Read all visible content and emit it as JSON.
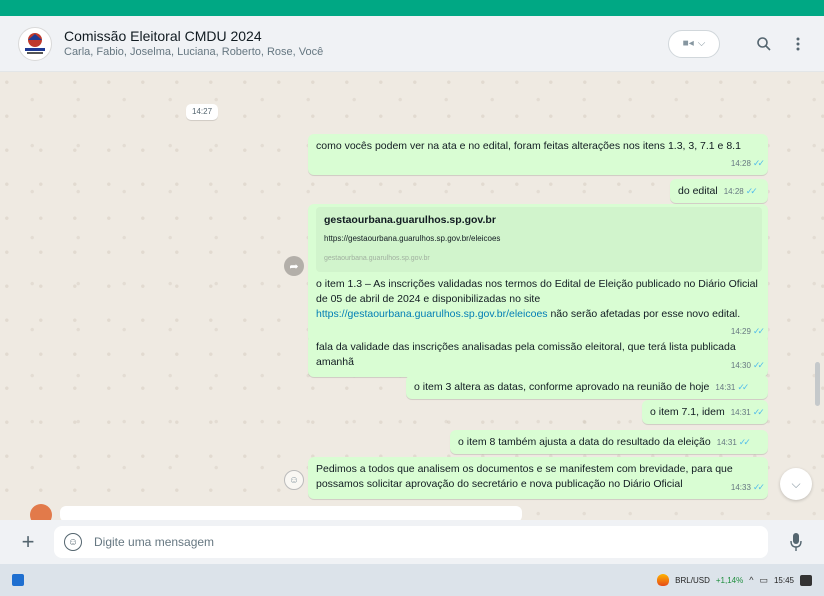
{
  "header": {
    "title": "Comissão Eleitoral CMDU 2024",
    "participants": "Carla, Fabio, Joselma, Luciana, Roberto, Rose, Você"
  },
  "date_chip": "14:27",
  "messages": [
    {
      "text": "como vocês podem ver na ata e no edital, foram feitas alterações nos itens 1.3, 3, 7.1 e 8.1",
      "time": "14:28"
    },
    {
      "text": "do edital",
      "time": "14:28"
    },
    {
      "link_preview": {
        "domain": "gestaourbana.guarulhos.sp.gov.br",
        "url": "https://gestaourbana.guarulhos.sp.gov.br/eleicoes",
        "small": "gestaourbana.guarulhos.sp.gov.br"
      },
      "text_before": "o item 1.3 – As inscrições validadas nos termos do Edital de Eleição publicado no Diário Oficial de 05 de abril de 2024 e disponibilizadas  no site ",
      "link": "https://gestaourbana.guarulhos.sp.gov.br/eleicoes",
      "text_after": " não serão afetadas por esse novo edital.",
      "time": "14:29"
    },
    {
      "text": "fala da validade das inscrições analisadas pela comissão eleitoral, que terá lista publicada amanhã",
      "time": "14:30"
    },
    {
      "text": "o item 3 altera as datas, conforme aprovado na reunião de hoje",
      "time": "14:31"
    },
    {
      "text": "o item 7.1, idem",
      "time": "14:31"
    },
    {
      "text": "o item 8 também ajusta a data do resultado da eleição",
      "time": "14:31"
    },
    {
      "text": "Pedimos a todos que analisem os documentos e se manifestem com brevidade, para que possamos solicitar aprovação do secretário e nova publicação no Diário Oficial",
      "time": "14:33"
    }
  ],
  "composer": {
    "placeholder": "Digite uma mensagem"
  },
  "taskbar": {
    "ticker": "BRL/USD",
    "change": "+1,14%",
    "clock": "15:45"
  },
  "colors": {
    "accent": "#00a884",
    "outgoing_bubble": "#d9fdd3",
    "read_ticks": "#53bdeb",
    "link": "#027eb5"
  },
  "icons": [
    "group-avatar-icon",
    "video-call-icon",
    "search-icon",
    "menu-icon",
    "forward-icon",
    "emoji-reaction-icon",
    "scroll-down-icon",
    "plus-icon",
    "emoji-icon",
    "mic-icon"
  ]
}
